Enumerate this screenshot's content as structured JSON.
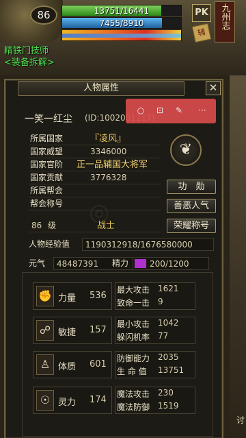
{
  "hud": {
    "level": "86",
    "hp_text": "13751/16441",
    "mp_text": "7455/8910",
    "pk_label": "PK",
    "scroll_label": "辅",
    "logo": "九州志",
    "npc_title_line1": "精铁门技师",
    "npc_title_line2": "<装备拆解>",
    "hp_fraction": 0.836,
    "mp_fraction": 0.837
  },
  "panel": {
    "title": "人物属性",
    "close_label": "✕",
    "char_name": "一笑一红尘",
    "char_id": "(ID:1002001117)",
    "overlay_icons": [
      "search-icon",
      "ai-icon",
      "magic-wand-icon",
      "more-icon"
    ],
    "info": [
      {
        "key": "所属国家",
        "value": "『凌风』"
      },
      {
        "key": "国家威望",
        "value": "3346000"
      },
      {
        "key": "国家官阶",
        "value": "正一品辅国大将军"
      },
      {
        "key": "国家贡献",
        "value": "3776328"
      },
      {
        "key": "所属帮会",
        "value": ""
      },
      {
        "key": "帮会称号",
        "value": ""
      }
    ],
    "level": "86",
    "level_unit": "级",
    "job": "战士",
    "buttons": [
      "功　勋",
      "善恶人气",
      "荣耀称号"
    ],
    "exp_label": "人物经验值",
    "exp_value": "1190312918/1676580000",
    "yuanqi_label": "元气",
    "yuanqi_value": "48487391",
    "jingli_label": "精力",
    "jingli_value": "200/1200",
    "stats": [
      {
        "icon": "fist-icon",
        "name": "力量",
        "value": "536",
        "r1": "最大攻击",
        "r1v": "1621",
        "r2": "致命一击",
        "r2v": "9"
      },
      {
        "icon": "leg-icon",
        "name": "敏捷",
        "value": "157",
        "r1": "最小攻击",
        "r1v": "1042",
        "r2": "躲闪机率",
        "r2v": "77"
      },
      {
        "icon": "torso-icon",
        "name": "体质",
        "value": "601",
        "r1": "防御能力",
        "r1v": "2035",
        "r2": "生 命 值",
        "r2v": "13751"
      },
      {
        "icon": "brain-icon",
        "name": "灵力",
        "value": "174",
        "r1": "魔法攻击",
        "r1v": "230",
        "r2": "魔法防御",
        "r2v": "1519"
      }
    ],
    "corner_text": "讨"
  }
}
